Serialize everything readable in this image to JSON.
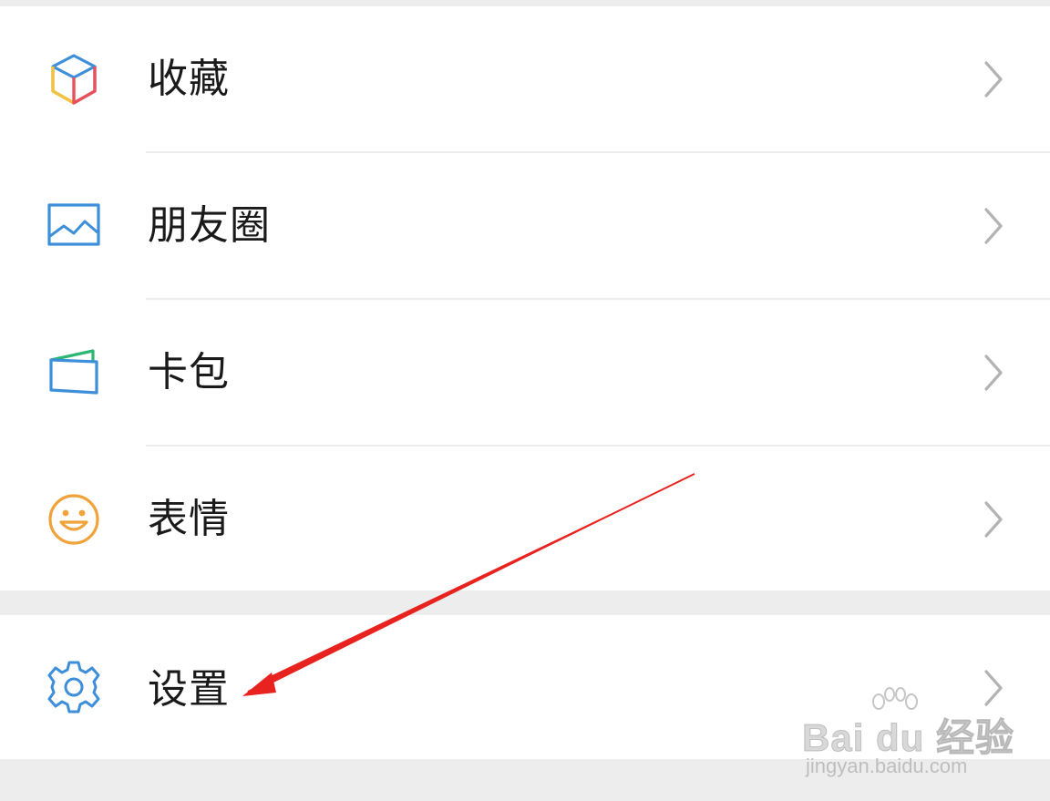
{
  "menu_groups": [
    {
      "items": [
        {
          "label": "收藏",
          "icon": "favorites-cube-icon"
        },
        {
          "label": "朋友圈",
          "icon": "moments-picture-icon"
        },
        {
          "label": "卡包",
          "icon": "card-wallet-icon"
        },
        {
          "label": "表情",
          "icon": "smiley-face-icon"
        }
      ]
    },
    {
      "items": [
        {
          "label": "设置",
          "icon": "gear-icon"
        }
      ]
    }
  ],
  "watermark": {
    "brand": "Bai du 经验",
    "url": "jingyan.baidu.com"
  },
  "colors": {
    "background": "#ededed",
    "row": "#ffffff",
    "text": "#1a1a1a",
    "chevron": "#b3b3b3",
    "icon_blue": "#3d8fd9",
    "icon_orange": "#f0a23b",
    "annotation_red": "#e8231f"
  }
}
